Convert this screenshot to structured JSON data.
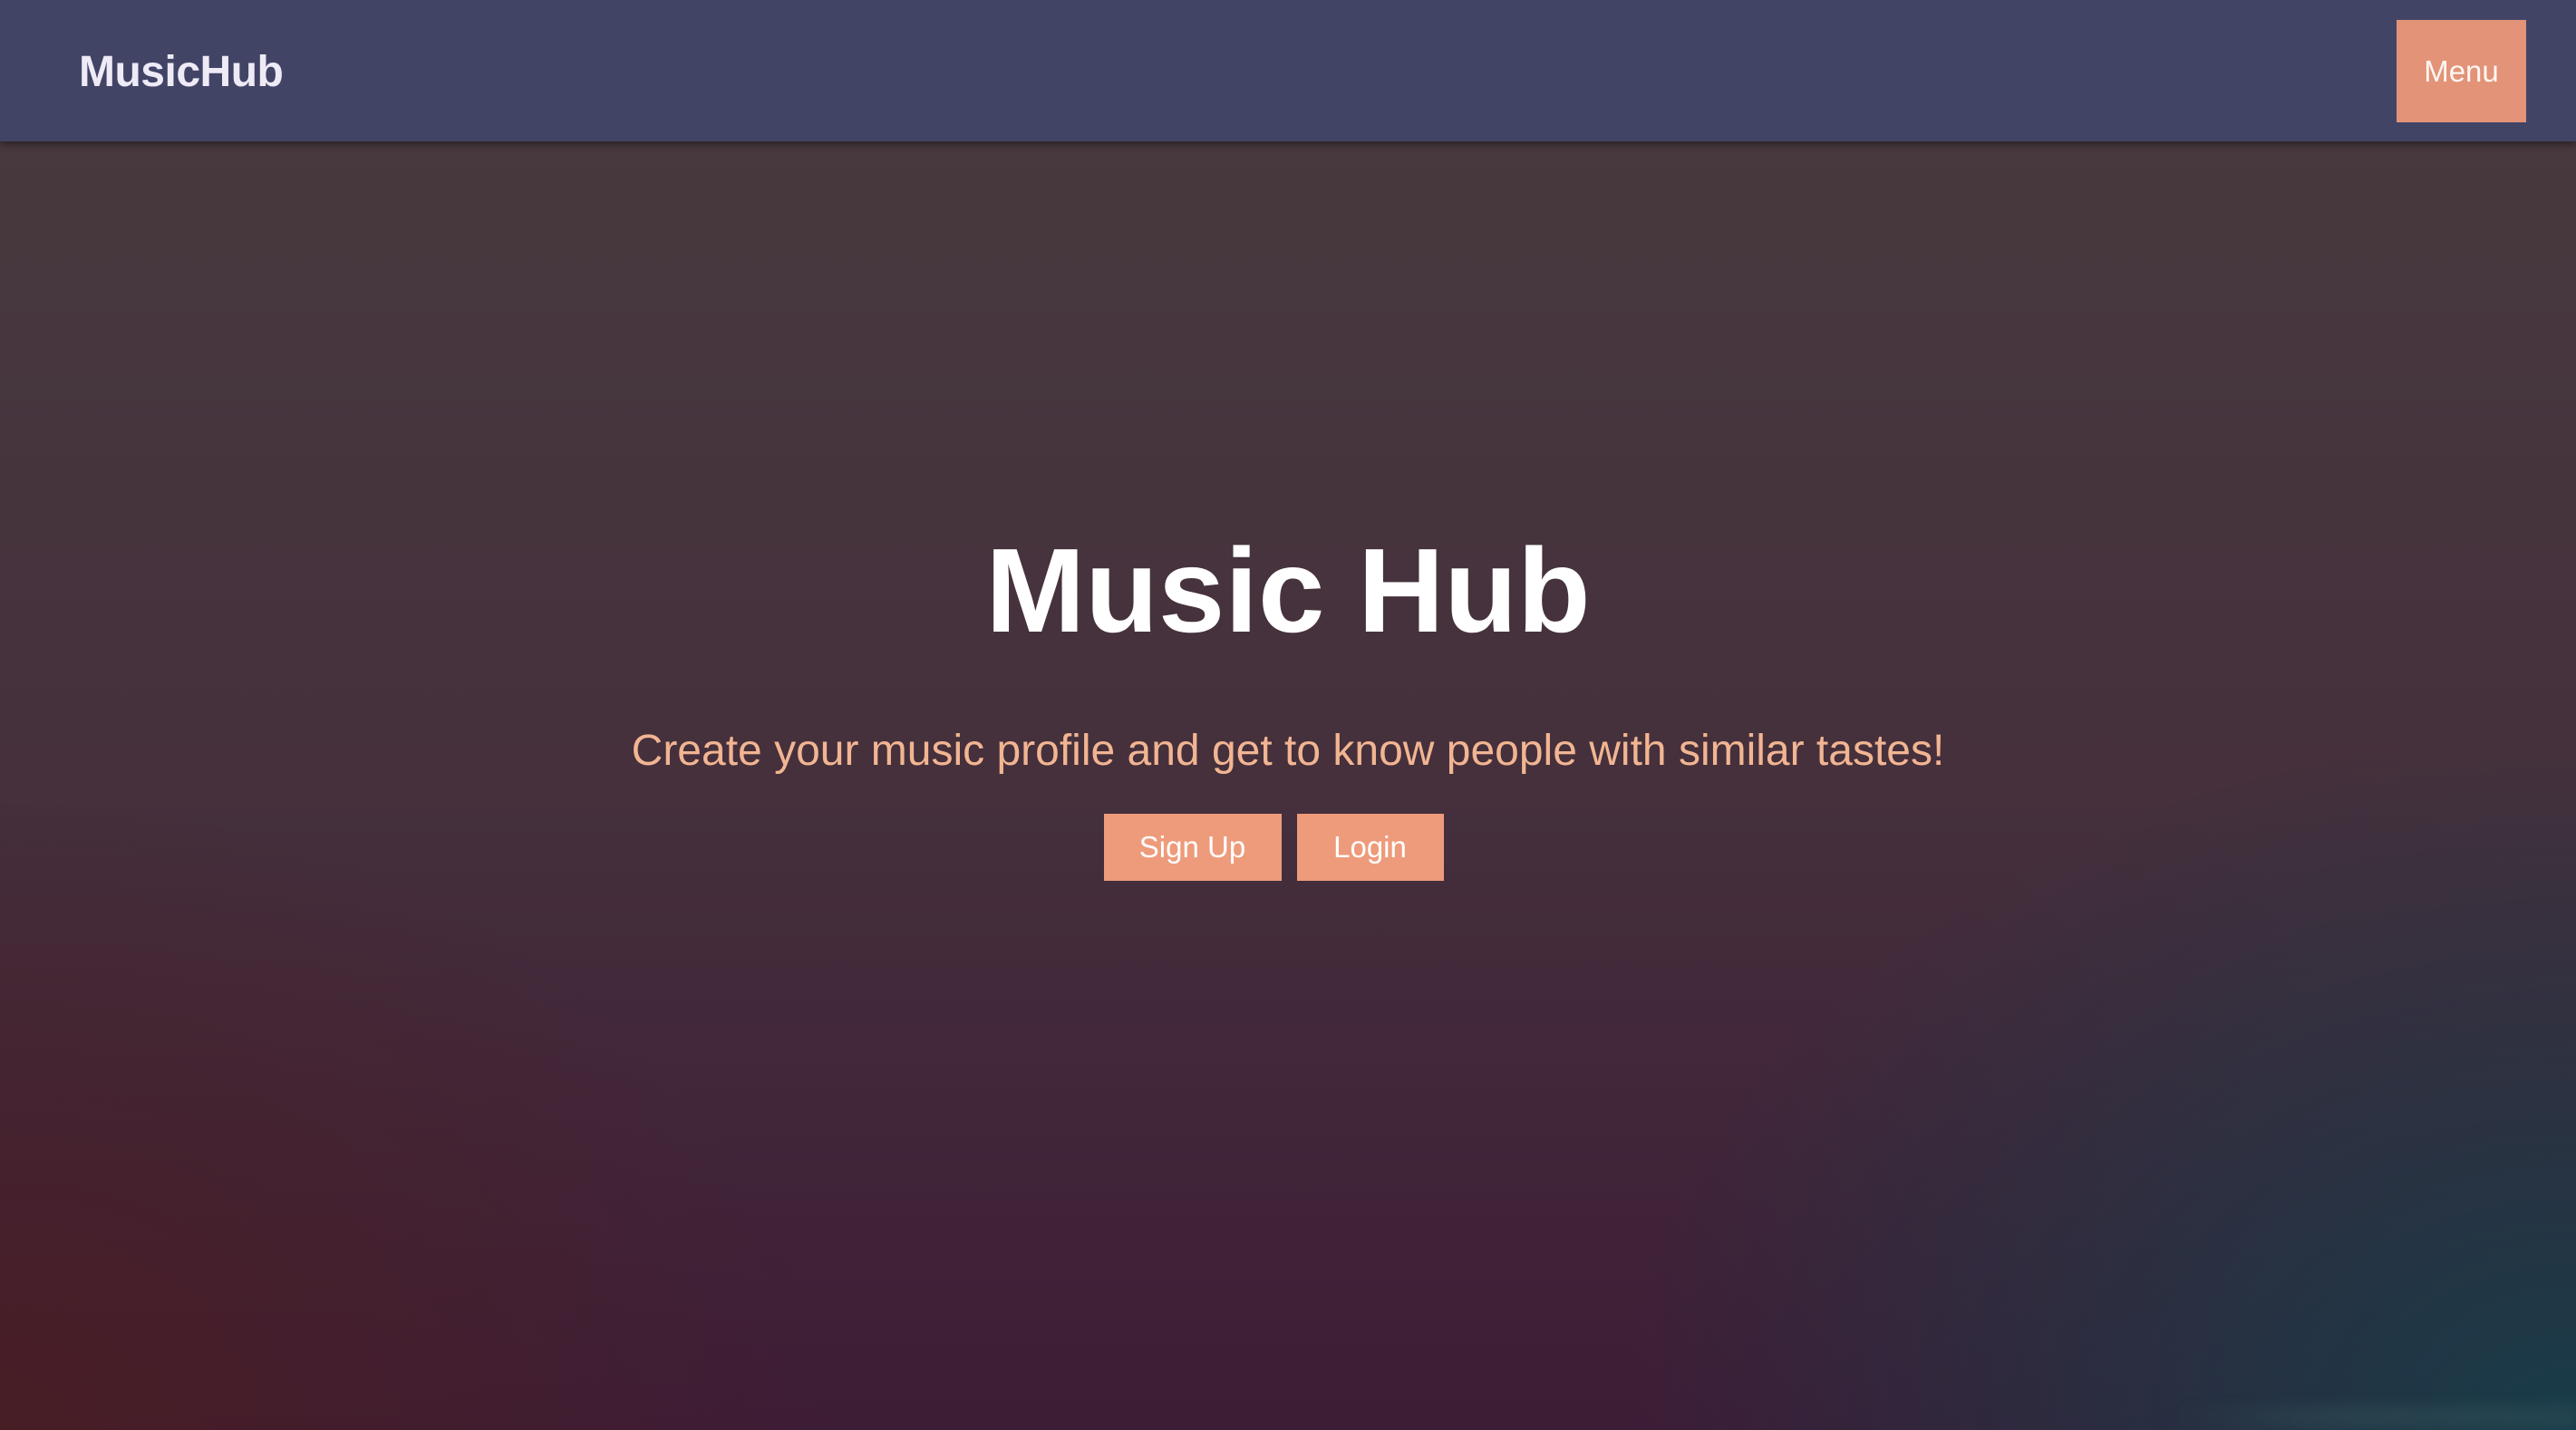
{
  "navbar": {
    "brand": "MusicHub",
    "menu_label": "Menu"
  },
  "hero": {
    "title": "Music Hub",
    "subtitle": "Create your music profile and get to know people with similar tastes!",
    "signup_label": "Sign Up",
    "login_label": "Login"
  },
  "colors": {
    "navbar_bg": "#424466",
    "accent": "#ee9b7b",
    "subtitle_text": "#f2b592",
    "title_text": "#ffffff"
  }
}
